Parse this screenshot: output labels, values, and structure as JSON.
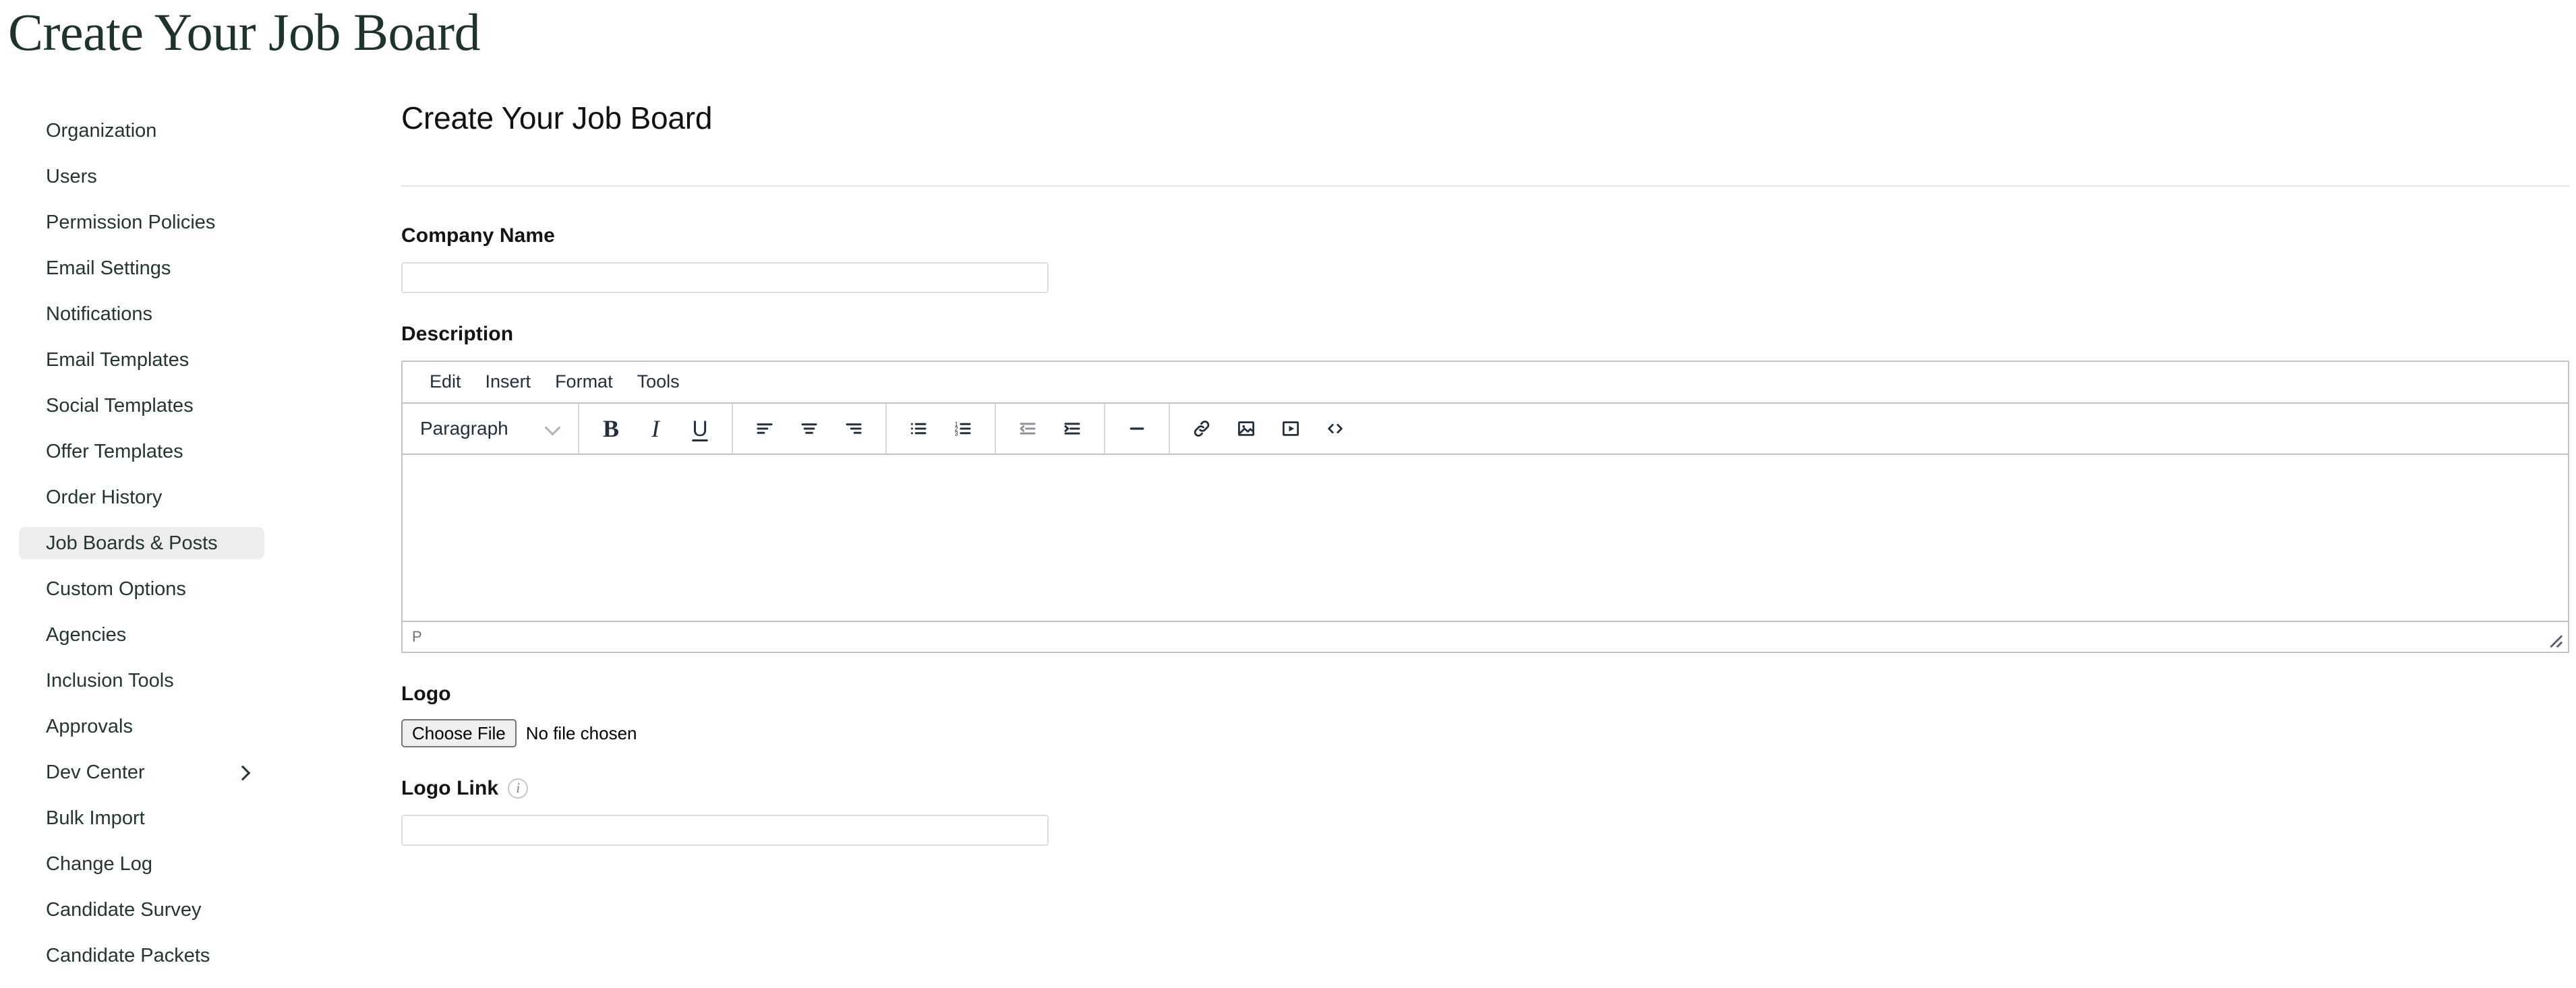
{
  "page": {
    "heading": "Create Your Job Board"
  },
  "sidebar": {
    "items": [
      {
        "label": "Organization",
        "active": false,
        "has_submenu": false
      },
      {
        "label": "Users",
        "active": false,
        "has_submenu": false
      },
      {
        "label": "Permission Policies",
        "active": false,
        "has_submenu": false
      },
      {
        "label": "Email Settings",
        "active": false,
        "has_submenu": false
      },
      {
        "label": "Notifications",
        "active": false,
        "has_submenu": false
      },
      {
        "label": "Email Templates",
        "active": false,
        "has_submenu": false
      },
      {
        "label": "Social Templates",
        "active": false,
        "has_submenu": false
      },
      {
        "label": "Offer Templates",
        "active": false,
        "has_submenu": false
      },
      {
        "label": "Order History",
        "active": false,
        "has_submenu": false
      },
      {
        "label": "Job Boards & Posts",
        "active": true,
        "has_submenu": false
      },
      {
        "label": "Custom Options",
        "active": false,
        "has_submenu": false
      },
      {
        "label": "Agencies",
        "active": false,
        "has_submenu": false
      },
      {
        "label": "Inclusion Tools",
        "active": false,
        "has_submenu": false
      },
      {
        "label": "Approvals",
        "active": false,
        "has_submenu": false
      },
      {
        "label": "Dev Center",
        "active": false,
        "has_submenu": true
      },
      {
        "label": "Bulk Import",
        "active": false,
        "has_submenu": false
      },
      {
        "label": "Change Log",
        "active": false,
        "has_submenu": false
      },
      {
        "label": "Candidate Survey",
        "active": false,
        "has_submenu": false
      },
      {
        "label": "Candidate Packets",
        "active": false,
        "has_submenu": false
      }
    ]
  },
  "form": {
    "title": "Create Your Job Board",
    "company_name": {
      "label": "Company Name",
      "value": "",
      "placeholder": ""
    },
    "description": {
      "label": "Description"
    },
    "logo": {
      "label": "Logo",
      "choose_button": "Choose File",
      "file_status": "No file chosen"
    },
    "logo_link": {
      "label": "Logo Link",
      "info_icon": "info-icon",
      "info_glyph": "i",
      "value": "",
      "placeholder": ""
    }
  },
  "editor": {
    "menubar": [
      {
        "label": "Edit"
      },
      {
        "label": "Insert"
      },
      {
        "label": "Format"
      },
      {
        "label": "Tools"
      }
    ],
    "format_select": {
      "value": "Paragraph"
    },
    "toolbar": [
      {
        "name": "bold",
        "title": "Bold",
        "disabled": false
      },
      {
        "name": "italic",
        "title": "Italic",
        "disabled": false
      },
      {
        "name": "underline",
        "title": "Underline",
        "disabled": false
      },
      {
        "name": "align-left",
        "title": "Align left",
        "disabled": false
      },
      {
        "name": "align-center",
        "title": "Align center",
        "disabled": false
      },
      {
        "name": "align-right",
        "title": "Align right",
        "disabled": false
      },
      {
        "name": "bullet-list",
        "title": "Bullet list",
        "disabled": false
      },
      {
        "name": "numbered-list",
        "title": "Numbered list",
        "disabled": false
      },
      {
        "name": "outdent",
        "title": "Decrease indent",
        "disabled": true
      },
      {
        "name": "indent",
        "title": "Increase indent",
        "disabled": false
      },
      {
        "name": "horizontal-rule",
        "title": "Horizontal line",
        "disabled": false
      },
      {
        "name": "link",
        "title": "Insert/edit link",
        "disabled": false
      },
      {
        "name": "image",
        "title": "Insert/edit image",
        "disabled": false
      },
      {
        "name": "media",
        "title": "Insert/edit media",
        "disabled": false
      },
      {
        "name": "source-code",
        "title": "Source code",
        "disabled": false
      }
    ],
    "content": "",
    "statusbar": {
      "element_path": "P",
      "resize_handle": "resize-grip-icon"
    }
  },
  "colors": {
    "brand_green": "#1d332c",
    "sidebar_text": "#23372f",
    "active_bg": "#ecedec",
    "editor_chrome": "#222f3e",
    "border": "#c2c4c6",
    "input_border": "#dedede",
    "muted_text": "#6d737c"
  }
}
